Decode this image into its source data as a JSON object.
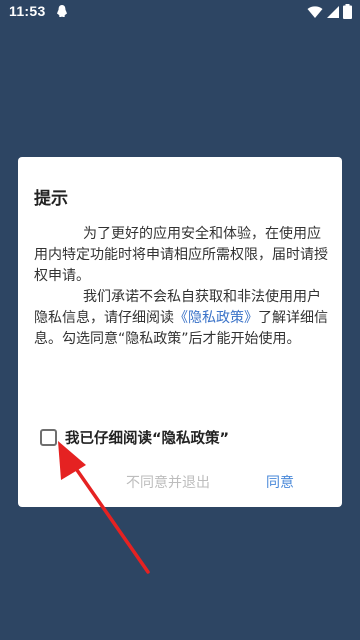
{
  "status_bar": {
    "time": "11:53",
    "notification_icon": "qq-penguin-icon",
    "icons": [
      "wifi-icon",
      "signal-icon",
      "battery-icon"
    ]
  },
  "dialog": {
    "title": "提示",
    "paragraph1": "为了更好的应用安全和体验，在使用应用内特定功能时将申请相应所需权限，届时请授权申请。",
    "paragraph2_before": "我们承诺不会私自获取和非法使用用户隐私信息，请仔细阅读",
    "paragraph2_link": "《隐私政策》",
    "paragraph2_after": "了解详细信息。勾选同意“隐私政策”后才能开始使用。",
    "checkbox_label": "我已仔细阅读“隐私政策”",
    "checkbox_checked": false,
    "disagree_button": "不同意并退出",
    "agree_button": "同意"
  },
  "colors": {
    "background": "#2d4563",
    "link": "#3b73c8",
    "agree": "#4a89d9",
    "disabled": "#bdbdbd",
    "annotation_arrow": "#e52222"
  }
}
